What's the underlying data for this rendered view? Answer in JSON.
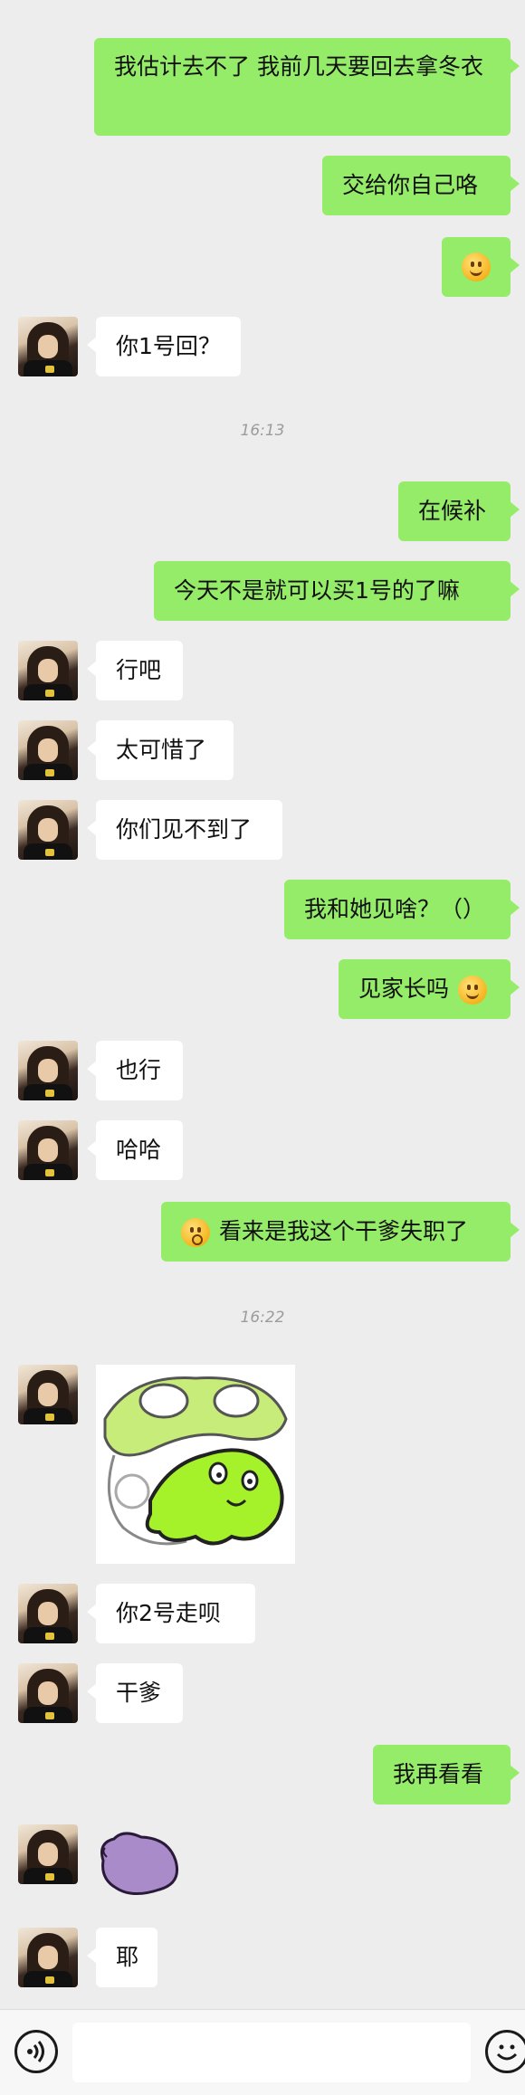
{
  "messages": {
    "m1": "我估计去不了 我前几天要回去拿冬衣",
    "m2": "交给你自己咯",
    "m4": "你1号回？",
    "time1": "16:13",
    "m5": "在候补",
    "m6": "今天不是就可以买1号的了嘛",
    "m7": "行吧",
    "m8": "太可惜了",
    "m9": "你们见不到了",
    "m10": "我和她见啥？（）",
    "m11": "见家长吗",
    "m12": "也行",
    "m13": "哈哈",
    "m14": "看来是我这个干爹失职了",
    "time2": "16:22",
    "m16": "你2号走呗",
    "m17": "干爹",
    "m18": "我再看看",
    "m20": "耶"
  },
  "icons": {
    "voice": "voice-icon",
    "emoji": "emoji-icon",
    "smile": "smile-emoji",
    "blush": "blush-emoji",
    "flushed": "flushed-emoji"
  },
  "colors": {
    "me_bubble": "#95ec69",
    "them_bubble": "#ffffff",
    "background": "#ededed"
  }
}
